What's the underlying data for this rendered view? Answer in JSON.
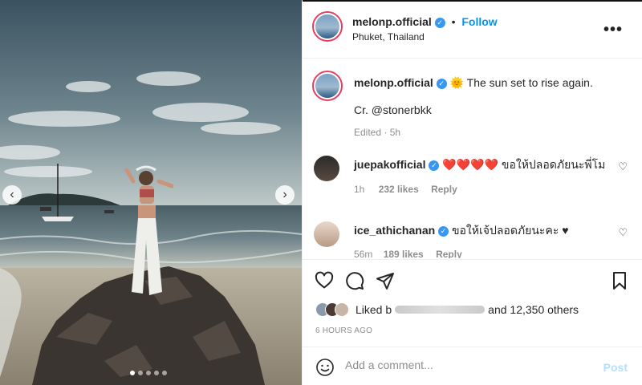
{
  "post": {
    "username": "melonp.official",
    "separator": "•",
    "follow_label": "Follow",
    "location": "Phuket, Thailand",
    "more_label": "•••",
    "caption_emoji": "🌞",
    "caption_text": "The sun set to rise again.",
    "credit": "Cr. @stonerbkk",
    "edited": "Edited · 5h"
  },
  "media": {
    "prev_label": "‹",
    "next_label": "›",
    "slide_count": 5,
    "active_slide": 1
  },
  "comments": [
    {
      "username": "juepakofficial",
      "hearts": "❤️❤️❤️❤️",
      "text": "ขอให้ปลอดภัยนะพี่โม",
      "time": "1h",
      "likes": "232 likes",
      "reply": "Reply"
    },
    {
      "username": "ice_athichanan",
      "text": "ขอให้เจ้ปลอดภัยนะคะ ♥",
      "time": "56m",
      "likes": "189 likes",
      "reply": "Reply"
    }
  ],
  "likes": {
    "prefix": "Liked b",
    "suffix": "and 12,350 others"
  },
  "timestamp": "6 HOURS AGO",
  "composer": {
    "placeholder": "Add a comment...",
    "post_label": "Post"
  },
  "colors": {
    "accent": "#0095f6",
    "verified": "#3897f0",
    "heart": "#ed4956",
    "story_ring": "#e4405f"
  }
}
